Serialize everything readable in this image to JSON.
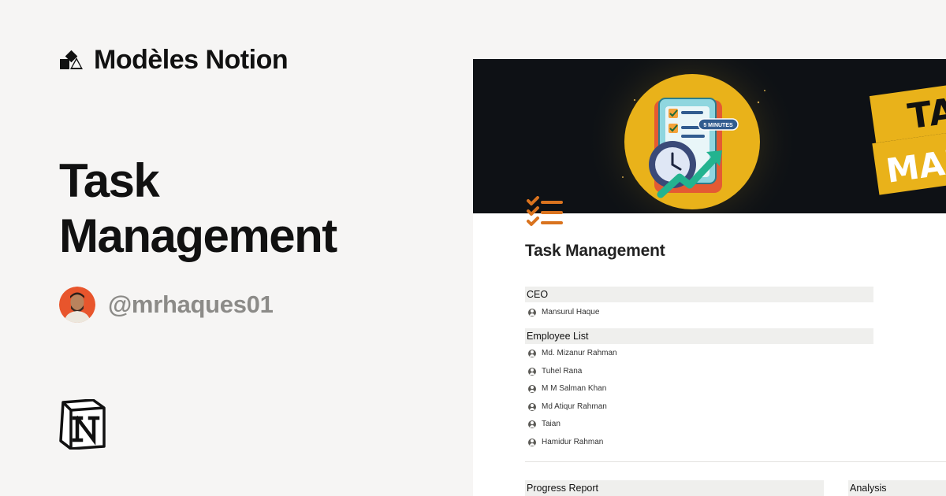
{
  "brand": {
    "name": "Modèles Notion",
    "logo_icon": "shapes-logo-icon"
  },
  "hero": {
    "title_line1": "Task",
    "title_line2": "Management"
  },
  "author": {
    "handle": "@mrhaques01",
    "avatar_bg": "#e8552c"
  },
  "notion_logo_icon": "notion-logo-icon",
  "preview": {
    "cover_badge": "5 MINUTES",
    "cover_side_text_top": "TA",
    "cover_side_text_bottom": "MANA",
    "page_icon": "checklist-icon",
    "page_title": "Task Management",
    "ceo_header": "CEO",
    "ceo_name": "Mansurul Haque",
    "employee_header": "Employee List",
    "employees": [
      "Md. Mizanur Rahman",
      "Tuhel Rana",
      "M M Salman Khan",
      "Md Atiqur Rahman",
      "Taian",
      "Hamidur Rahman"
    ],
    "progress_header": "Progress Report",
    "analysis_header": "Analysis"
  },
  "colors": {
    "background": "#f6f5f4",
    "accent_orange": "#d9731f",
    "cover_gold": "#e9b21a",
    "handle_gray": "#8c8b88"
  }
}
